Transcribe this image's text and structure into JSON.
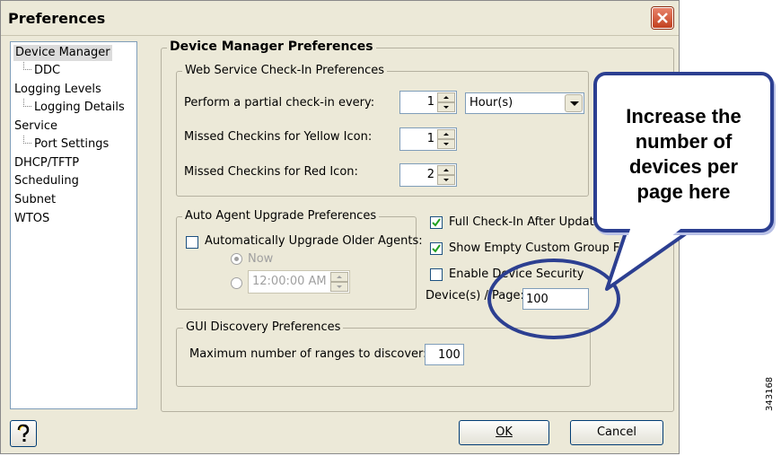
{
  "window": {
    "title": "Preferences",
    "close_icon": "close-icon"
  },
  "tree": {
    "items": [
      {
        "label": "Device Manager",
        "selected": true
      },
      {
        "label": "DDC",
        "child": true
      },
      {
        "label": "Logging Levels"
      },
      {
        "label": "Logging Details",
        "child": true
      },
      {
        "label": "Service"
      },
      {
        "label": "Port Settings",
        "child": true
      },
      {
        "label": "DHCP/TFTP"
      },
      {
        "label": "Scheduling"
      },
      {
        "label": "Subnet"
      },
      {
        "label": "WTOS"
      }
    ]
  },
  "panel": {
    "title": "Device Manager Preferences",
    "web_service": {
      "title": "Web Service Check-In Preferences",
      "partial_label": "Perform a partial check-in every:",
      "partial_value": "1",
      "partial_unit": "Hour(s)",
      "yellow_label": "Missed Checkins for Yellow Icon:",
      "yellow_value": "1",
      "red_label": "Missed Checkins for Red Icon:",
      "red_value": "2"
    },
    "auto_agent": {
      "title": "Auto Agent Upgrade Preferences",
      "auto_label": "Automatically Upgrade Older Agents:",
      "auto_checked": false,
      "now_label": "Now",
      "time_value": "12:00:00 AM"
    },
    "options": {
      "full_checkin_label": "Full Check-In After Update",
      "full_checkin_checked": true,
      "show_empty_label": "Show Empty Custom Group Folders",
      "show_empty_checked": true,
      "device_security_label": "Enable Device Security",
      "device_security_checked": false,
      "devices_per_page_label": "Device(s) / Page:",
      "devices_per_page_value": "100"
    },
    "gui_discovery": {
      "title": "GUI Discovery Preferences",
      "max_ranges_label": "Maximum number of ranges to discover:",
      "max_ranges_value": "100"
    }
  },
  "buttons": {
    "ok": "OK",
    "cancel": "Cancel",
    "help_icon": "question-mark-icon"
  },
  "callout": {
    "text": "Increase the number of devices per page here",
    "color": "#2c3f91"
  },
  "figure_id": "343168"
}
